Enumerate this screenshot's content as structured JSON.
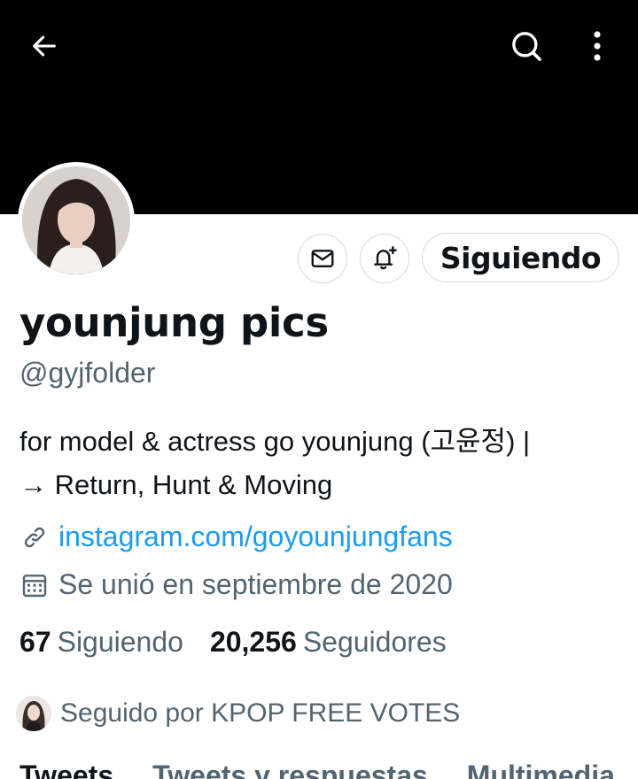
{
  "header": {
    "back_icon": "arrow-left-icon",
    "search_icon": "search-icon",
    "more_icon": "more-vertical-icon",
    "banner_color": "#000000"
  },
  "profile": {
    "name": "younjung pics",
    "handle": "@gyjfolder",
    "bio_lines": [
      "for model & actress go younjung (고윤정) |",
      "→ Return, Hunt & Moving"
    ],
    "link": "instagram.com/goyounjungfans",
    "joined": "Se unió en septiembre de 2020"
  },
  "actions": {
    "message_icon": "mail-icon",
    "notify_icon": "bell-plus-icon",
    "follow_label": "Siguiendo"
  },
  "stats": {
    "following_count": "67",
    "following_label": "Siguiendo",
    "followers_count": "20,256",
    "followers_label": "Seguidores"
  },
  "followed_by": {
    "text": "Seguido por KPOP FREE VOTES"
  },
  "tabs": [
    {
      "label": "Tweets",
      "active": true
    },
    {
      "label": "Tweets y respuestas",
      "active": false
    },
    {
      "label": "Multimedia",
      "active": false
    }
  ],
  "colors": {
    "link": "#1d9bf0",
    "secondary_text": "#536471",
    "primary_text": "#0f1419",
    "border": "#cfd9de"
  }
}
